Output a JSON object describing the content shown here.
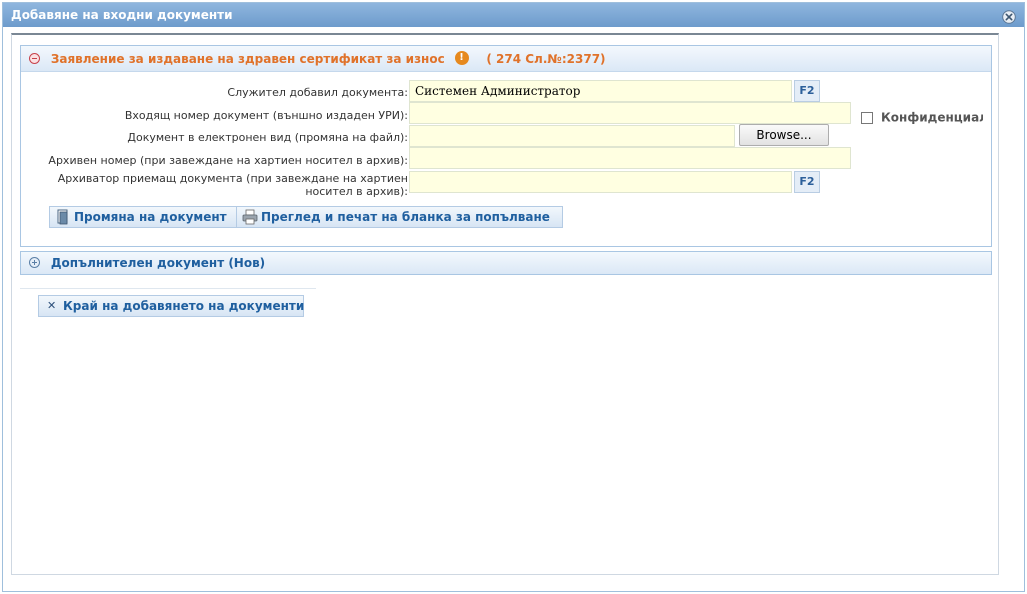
{
  "window": {
    "title": "Добавяне на входни документи"
  },
  "main_panel": {
    "title": "Заявление за издаване на здравен сертификат за износ",
    "meta": "( 274 Сл.№:2377)",
    "fields": {
      "employee_label": "Служител добавил документа:",
      "employee_value": "Системен Администратор",
      "incoming_number_label": "Входящ номер документ (външно издаден УРИ):",
      "incoming_number_value": "",
      "electronic_doc_label": "Документ в електронен вид (промяна на файл):",
      "electronic_doc_value": "",
      "archive_number_label": "Архивен номер (при завеждане на хартиен носител в архив):",
      "archive_number_value": "",
      "archiver_label_line1": "Архиватор приемащ документа (при завеждане на хартиен",
      "archiver_label_line2": "носител в архив):",
      "archiver_value": ""
    },
    "f2_label": "F2",
    "browse_label": "Browse...",
    "confidential_label": "Конфиденциално",
    "confidential_checked": false,
    "buttons": {
      "change_document": "Промяна на документ",
      "preview_print": "Преглед и печат на бланка за попълване"
    }
  },
  "additional_panel": {
    "title": "Допълнителен документ (Нов)"
  },
  "end_button": {
    "label": "Край на добавянето на документи"
  },
  "colors": {
    "title_bar": "#7aa6d6",
    "accent_orange": "#e0722a",
    "accent_blue": "#1f5f9f",
    "input_bg": "#ffffe1"
  }
}
